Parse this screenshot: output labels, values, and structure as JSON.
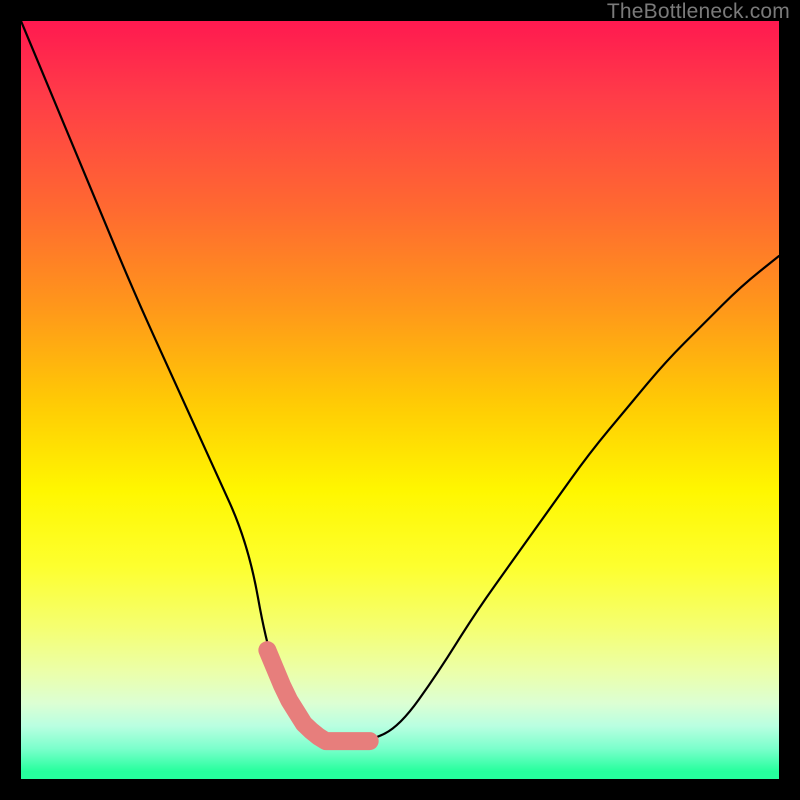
{
  "watermark": "TheBottleneck.com",
  "chart_data": {
    "type": "line",
    "title": "",
    "xlabel": "",
    "ylabel": "",
    "xlim": [
      0,
      1
    ],
    "ylim": [
      0,
      1
    ],
    "series": [
      {
        "name": "bottleneck-curve",
        "x": [
          0.0,
          0.05,
          0.1,
          0.15,
          0.2,
          0.25,
          0.3,
          0.325,
          0.35,
          0.375,
          0.4,
          0.43,
          0.46,
          0.5,
          0.55,
          0.6,
          0.65,
          0.7,
          0.75,
          0.8,
          0.85,
          0.9,
          0.95,
          1.0
        ],
        "y": [
          1.0,
          0.88,
          0.76,
          0.64,
          0.53,
          0.42,
          0.31,
          0.17,
          0.11,
          0.07,
          0.05,
          0.05,
          0.05,
          0.07,
          0.14,
          0.22,
          0.29,
          0.36,
          0.43,
          0.49,
          0.55,
          0.6,
          0.65,
          0.69
        ]
      }
    ],
    "highlight_segment": {
      "name": "minimum-region",
      "x_range": [
        0.325,
        0.46
      ],
      "color": "#e77e7c"
    },
    "gradient": {
      "direction": "vertical",
      "stops": [
        {
          "pos": 0.0,
          "color": "#ff1950"
        },
        {
          "pos": 0.5,
          "color": "#fff700"
        },
        {
          "pos": 1.0,
          "color": "#26ff9d"
        }
      ]
    }
  }
}
